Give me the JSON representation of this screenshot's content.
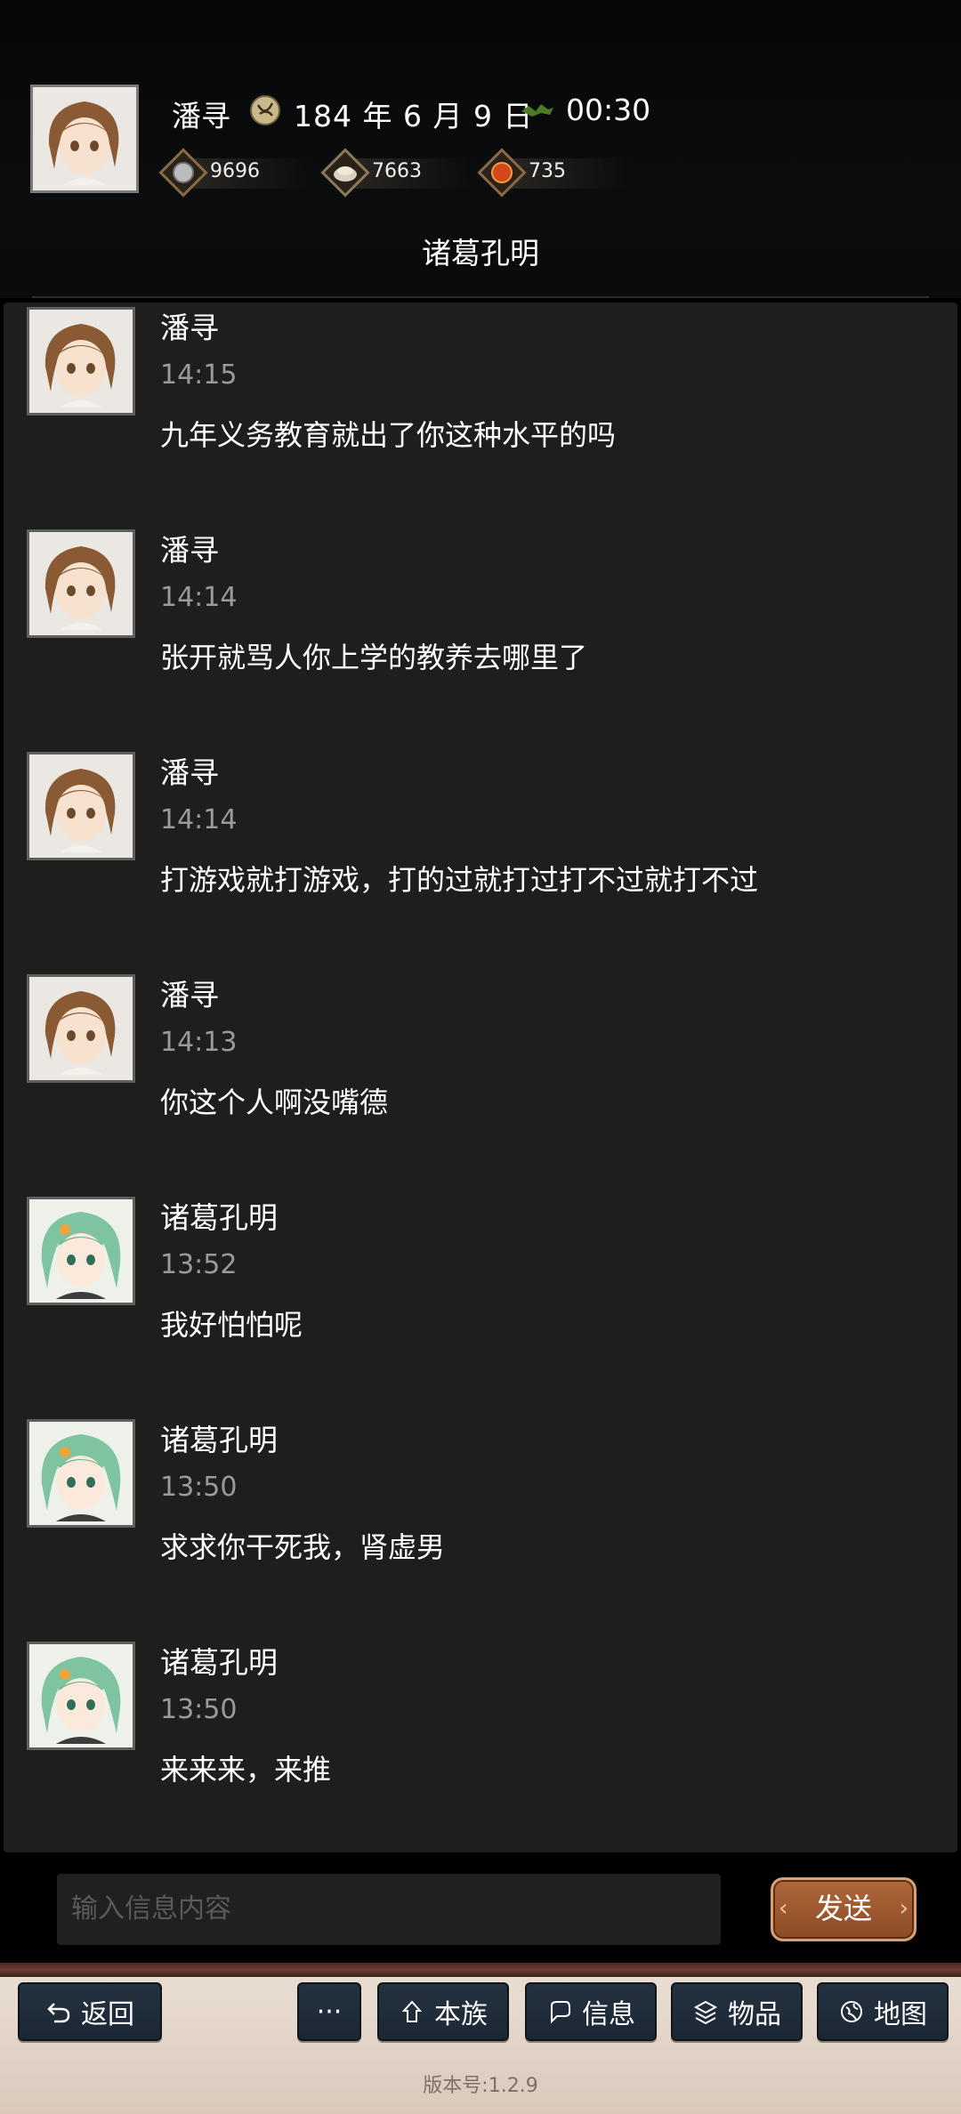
{
  "header": {
    "player_name": "潘寻",
    "date": "184 年 6 月 9 日",
    "time": "00:30",
    "resources": [
      {
        "icon": "silver-coin-icon",
        "value": "9696"
      },
      {
        "icon": "grain-icon",
        "value": "7663"
      },
      {
        "icon": "red-seal-icon",
        "value": "735"
      }
    ],
    "chat_title": "诸葛孔明"
  },
  "messages": [
    {
      "sender": "潘寻",
      "avatar": "brown-hair-avatar",
      "time": "14:15",
      "text": "九年义务教育就出了你这种水平的吗"
    },
    {
      "sender": "潘寻",
      "avatar": "brown-hair-avatar",
      "time": "14:14",
      "text": "张开就骂人你上学的教养去哪里了"
    },
    {
      "sender": "潘寻",
      "avatar": "brown-hair-avatar",
      "time": "14:14",
      "text": "打游戏就打游戏，打的过就打过打不过就打不过"
    },
    {
      "sender": "潘寻",
      "avatar": "brown-hair-avatar",
      "time": "14:13",
      "text": "你这个人啊没嘴德"
    },
    {
      "sender": "诸葛孔明",
      "avatar": "green-hair-avatar",
      "time": "13:52",
      "text": "我好怕怕呢"
    },
    {
      "sender": "诸葛孔明",
      "avatar": "green-hair-avatar",
      "time": "13:50",
      "text": "求求你干死我，肾虚男"
    },
    {
      "sender": "诸葛孔明",
      "avatar": "green-hair-avatar",
      "time": "13:50",
      "text": "来来来，来推"
    }
  ],
  "input": {
    "placeholder": "输入信息内容",
    "send_label": "发送"
  },
  "nav": {
    "back": "返回",
    "more": "···",
    "clan": "本族",
    "info": "信息",
    "items": "物品",
    "map": "地图"
  },
  "version": "版本号:1.2.9",
  "colors": {
    "accent": "#a85f35",
    "nav_button": "#1f2b38",
    "panel": "#1e1f1d"
  }
}
